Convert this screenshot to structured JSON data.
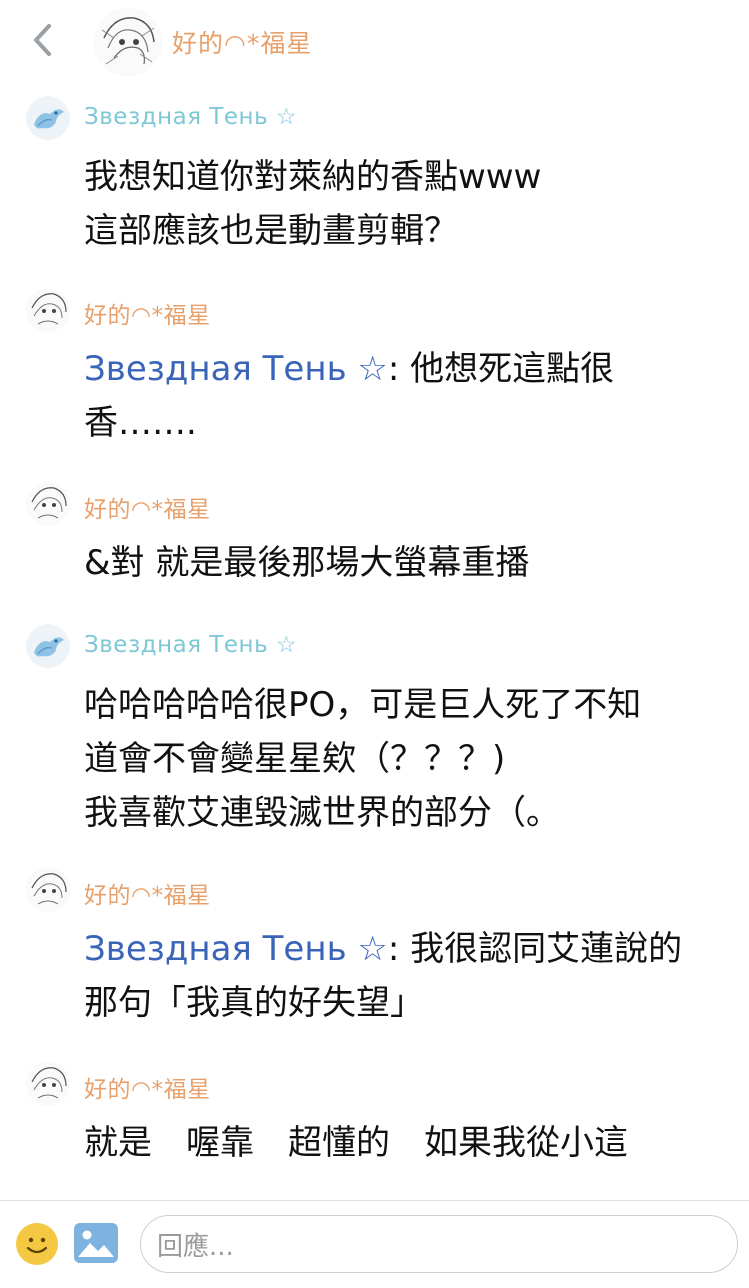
{
  "header": {
    "title": "好的◠*福星",
    "back_icon": "chevron-left-icon",
    "avatar_icon": "sketch-avatar-icon"
  },
  "messages": [
    {
      "sender": "Звездная Тень ☆",
      "sender_color": "#7ec8d6",
      "avatar": "blue-dragon-avatar",
      "lines": [
        "我想知道你對萊納的香點www",
        "這部應該也是動畫剪輯？"
      ]
    },
    {
      "sender": "好的◠*福星",
      "sender_color": "#e8a06a",
      "avatar": "sketch-avatar",
      "mention": "Звездная Тень ☆",
      "mention_color": "#3a64b8",
      "line1_rest": ": 他想死這點很",
      "line2": "香……."
    },
    {
      "sender": "好的◠*福星",
      "sender_color": "#e8a06a",
      "avatar": "sketch-avatar",
      "lines": [
        "&對 就是最後那場大螢幕重播"
      ]
    },
    {
      "sender": "Звездная Тень ☆",
      "sender_color": "#7ec8d6",
      "avatar": "blue-dragon-avatar",
      "lines": [
        "哈哈哈哈哈很PO，可是巨人死了不知",
        "道會不會變星星欸（？？？)",
        "我喜歡艾連毀滅世界的部分（。"
      ]
    },
    {
      "sender": "好的◠*福星",
      "sender_color": "#e8a06a",
      "avatar": "sketch-avatar",
      "mention": "Звездная Тень ☆",
      "mention_color": "#3a64b8",
      "line1_rest": ": 我很認同艾蓮說的",
      "line2": "那句「我真的好失望」"
    },
    {
      "sender": "好的◠*福星",
      "sender_color": "#e8a06a",
      "avatar": "sketch-avatar",
      "lines": [
        "就是　喔靠　超懂的　如果我從小這"
      ]
    }
  ],
  "composer": {
    "placeholder": "回應...",
    "emoji_icon": "smiley-icon",
    "image_icon": "image-icon"
  }
}
